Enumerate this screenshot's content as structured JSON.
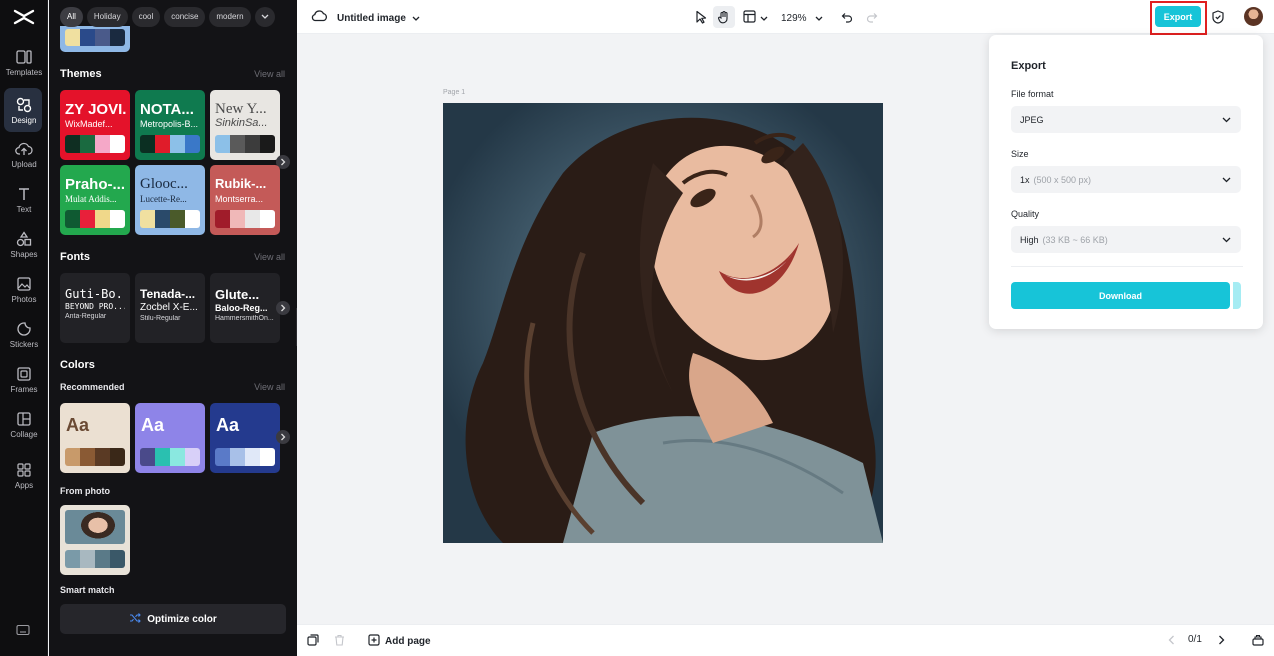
{
  "colors": {
    "accent": "#17c4d8",
    "rail_bg": "#0e0e10",
    "panel_bg": "#131316",
    "canvas_bg": "#f2f3f5",
    "highlight": "#e02020"
  },
  "rail": {
    "items": [
      {
        "label": "Templates",
        "icon": "templates-icon"
      },
      {
        "label": "Design",
        "icon": "design-icon"
      },
      {
        "label": "Upload",
        "icon": "upload-icon"
      },
      {
        "label": "Text",
        "icon": "text-icon"
      },
      {
        "label": "Shapes",
        "icon": "shapes-icon"
      },
      {
        "label": "Photos",
        "icon": "photos-icon"
      },
      {
        "label": "Stickers",
        "icon": "stickers-icon"
      },
      {
        "label": "Frames",
        "icon": "frames-icon"
      },
      {
        "label": "Collage",
        "icon": "collage-icon"
      },
      {
        "label": "Apps",
        "icon": "apps-icon"
      }
    ],
    "active": "Design"
  },
  "panel": {
    "chips": [
      "All",
      "Holiday",
      "cool",
      "concise",
      "modern"
    ],
    "active_chip": "All",
    "themes": {
      "title": "Themes",
      "view_all": "View all",
      "tiles": [
        {
          "t1": "ZY JOVI...",
          "t2": "WixMadef...",
          "bg": "#e4122a",
          "fg": "#ffffff",
          "sw": [
            "#0f2e22",
            "#1a6a40",
            "#f5a8c8",
            "#ffffff"
          ]
        },
        {
          "t1": "NOTA...",
          "t2": "Metropolis-B...",
          "bg": "#0f7a4f",
          "fg": "#ffffff",
          "sw": [
            "#0b2f22",
            "#e01c2a",
            "#8cc0e8",
            "#3a78c8"
          ]
        },
        {
          "t1": "New Y...",
          "t2": "SinkinSa...",
          "bg": "#e8e6e2",
          "fg": "#4a4a4a",
          "sw": [
            "#8cc0e8",
            "#5a5a5a",
            "#3c3c3c",
            "#1a1a1a"
          ]
        },
        {
          "t1": "Praho-...",
          "t2": "Mulat Addis...",
          "bg": "#23a84e",
          "fg": "#ffffff",
          "sw": [
            "#0f5a32",
            "#e8203a",
            "#f0d88a",
            "#ffffff"
          ]
        },
        {
          "t1": "Glooc...",
          "t2": "Lucette-Re...",
          "bg": "#8fb8e6",
          "fg": "#1a2a40",
          "sw": [
            "#f0e0a0",
            "#2a4a6a",
            "#4a5a2a",
            "#ffffff"
          ]
        },
        {
          "t1": "Rubik-...",
          "t2": "Montserra...",
          "bg": "#c45a58",
          "fg": "#ffffff",
          "sw": [
            "#a01c2a",
            "#f0b8b8",
            "#e8e8e8",
            "#ffffff"
          ]
        }
      ]
    },
    "fonts": {
      "title": "Fonts",
      "view_all": "View all",
      "tiles": [
        {
          "f1": "Guti-Bo...",
          "f2": "BEYOND PRO...",
          "f3": "Anta-Regular"
        },
        {
          "f1": "Tenada-...",
          "f2": "Zocbel X-E...",
          "f3": "Stilu-Regular"
        },
        {
          "f1": "Glute...",
          "f2": "Baloo-Reg...",
          "f3": "HammersmithOn..."
        }
      ]
    },
    "colors_section": {
      "title": "Colors",
      "recommended": "Recommended",
      "view_all": "View all",
      "tiles": [
        {
          "aa": "Aa",
          "bg": "#ebe0d2",
          "fg": "#6a4a34",
          "sw": [
            "#c89a6a",
            "#8a5a34",
            "#5a3a24",
            "#3a2818"
          ]
        },
        {
          "aa": "Aa",
          "bg": "#8e84e8",
          "fg": "#ffffff",
          "sw": [
            "#4a4a8a",
            "#2ac0b0",
            "#8ae8e0",
            "#d8d0f8"
          ]
        },
        {
          "aa": "Aa",
          "bg": "#243a8e",
          "fg": "#ffffff",
          "sw": [
            "#5a7ac8",
            "#a8c0e8",
            "#e0e8f8",
            "#ffffff"
          ]
        }
      ],
      "from_photo": "From photo",
      "photo_swatches": [
        "#7a9aa8",
        "#a8b8c0",
        "#5a7a88",
        "#3a5868"
      ],
      "smart_match": "Smart match",
      "optimize": "Optimize color"
    }
  },
  "topbar": {
    "doc_title": "Untitled image",
    "zoom": "129%",
    "export_label": "Export"
  },
  "canvas": {
    "page_label": "Page 1"
  },
  "export_panel": {
    "title": "Export",
    "file_format_label": "File format",
    "file_format_value": "JPEG",
    "size_label": "Size",
    "size_value": "1x",
    "size_hint": "(500 x 500 px)",
    "quality_label": "Quality",
    "quality_value": "High",
    "quality_hint": "(33 KB ~ 66 KB)",
    "download_label": "Download"
  },
  "bottombar": {
    "add_page": "Add page",
    "page_count": "0/1"
  }
}
